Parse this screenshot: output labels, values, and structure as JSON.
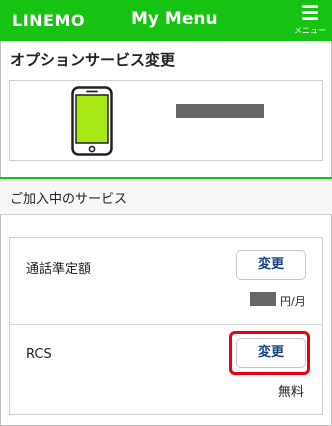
{
  "header": {
    "logo": "LINEMO",
    "title": "My Menu",
    "menu_label": "メニュー"
  },
  "option_section": {
    "title": "オプションサービス変更"
  },
  "subscribed_section": {
    "title": "ご加入中のサービス",
    "rows": [
      {
        "label": "通話準定額",
        "button_label": "変更",
        "fee_unit": "円/月"
      },
      {
        "label": "RCS",
        "button_label": "変更",
        "fee": "無料"
      }
    ]
  },
  "colors": {
    "brand_green": "#17c312",
    "button_text": "#1c3f8c",
    "highlight_red": "#e60012",
    "masked_gray": "#666666"
  },
  "icons": {
    "phone": "smartphone-icon",
    "menu": "hamburger-menu-icon"
  }
}
